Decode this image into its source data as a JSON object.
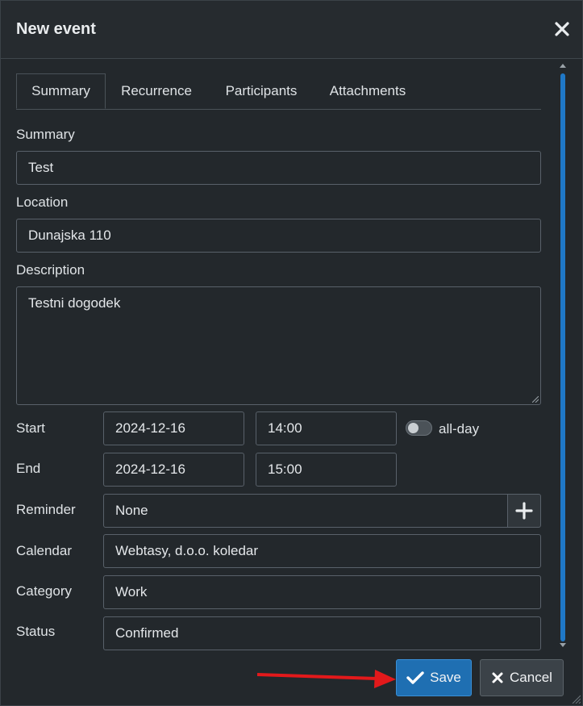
{
  "dialog": {
    "title": "New event"
  },
  "tabs": [
    {
      "label": "Summary"
    },
    {
      "label": "Recurrence"
    },
    {
      "label": "Participants"
    },
    {
      "label": "Attachments"
    }
  ],
  "form": {
    "summary": {
      "label": "Summary",
      "value": "Test"
    },
    "location": {
      "label": "Location",
      "value": "Dunajska 110"
    },
    "description": {
      "label": "Description",
      "value": "Testni dogodek"
    },
    "start": {
      "label": "Start",
      "date": "2024-12-16",
      "time": "14:00"
    },
    "allday": {
      "label": "all-day",
      "enabled": false
    },
    "end": {
      "label": "End",
      "date": "2024-12-16",
      "time": "15:00"
    },
    "reminder": {
      "label": "Reminder",
      "value": "None"
    },
    "calendar": {
      "label": "Calendar",
      "value": "Webtasy, d.o.o. koledar"
    },
    "category": {
      "label": "Category",
      "value": "Work"
    },
    "status": {
      "label": "Status",
      "value": "Confirmed"
    }
  },
  "buttons": {
    "save": "Save",
    "cancel": "Cancel"
  },
  "colors": {
    "accent": "#1f6fb2",
    "annotation_arrow": "#e3191b"
  }
}
